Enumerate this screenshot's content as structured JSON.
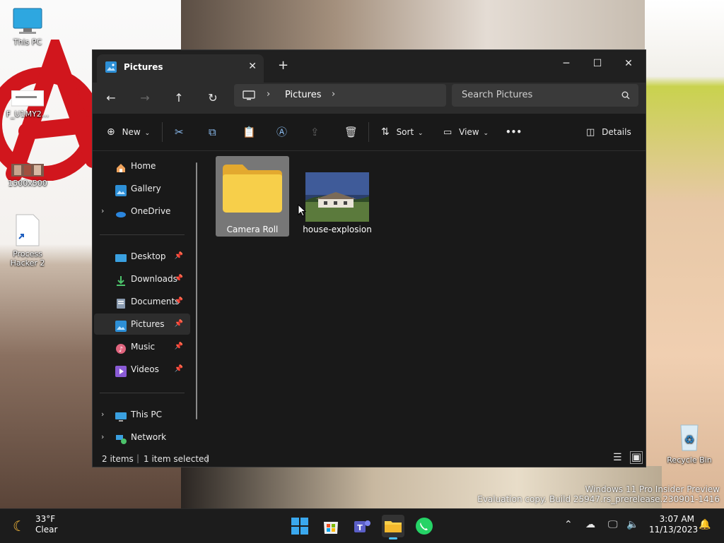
{
  "desktop": {
    "icons": [
      {
        "label": "This PC"
      },
      {
        "label": "F_U1MY2..."
      },
      {
        "label": "1500x500"
      },
      {
        "label": "Process Hacker 2"
      },
      {
        "label": "Recycle Bin"
      }
    ],
    "watermark": {
      "line1": "Windows 11 Pro Insider Preview",
      "line2": "Evaluation copy. Build 25947.rs_prerelease.230901-1416"
    }
  },
  "window": {
    "tab_title": "Pictures",
    "new_tab": "+",
    "address": {
      "crumb": "Pictures"
    },
    "search_placeholder": "Search Pictures",
    "toolbar": {
      "new_label": "New",
      "sort_label": "Sort",
      "view_label": "View",
      "more_label": "•••",
      "details_label": "Details"
    },
    "nav": {
      "items": [
        {
          "label": "Home"
        },
        {
          "label": "Gallery"
        },
        {
          "label": "OneDrive"
        },
        {
          "label": "Desktop"
        },
        {
          "label": "Downloads"
        },
        {
          "label": "Documents"
        },
        {
          "label": "Pictures"
        },
        {
          "label": "Music"
        },
        {
          "label": "Videos"
        },
        {
          "label": "This PC"
        },
        {
          "label": "Network"
        }
      ]
    },
    "files": [
      {
        "name": "Camera Roll",
        "type": "folder"
      },
      {
        "name": "house-explosion",
        "type": "image"
      }
    ],
    "status": {
      "count": "2 items",
      "selected": "1 item selected"
    }
  },
  "taskbar": {
    "weather": {
      "temp": "33°F",
      "condition": "Clear"
    },
    "clock": {
      "time": "3:07 AM",
      "date": "11/13/2023"
    }
  },
  "colors": {
    "accent": "#4cc2ff",
    "folder": "#f7cf4a",
    "selected_item": "#777777"
  }
}
